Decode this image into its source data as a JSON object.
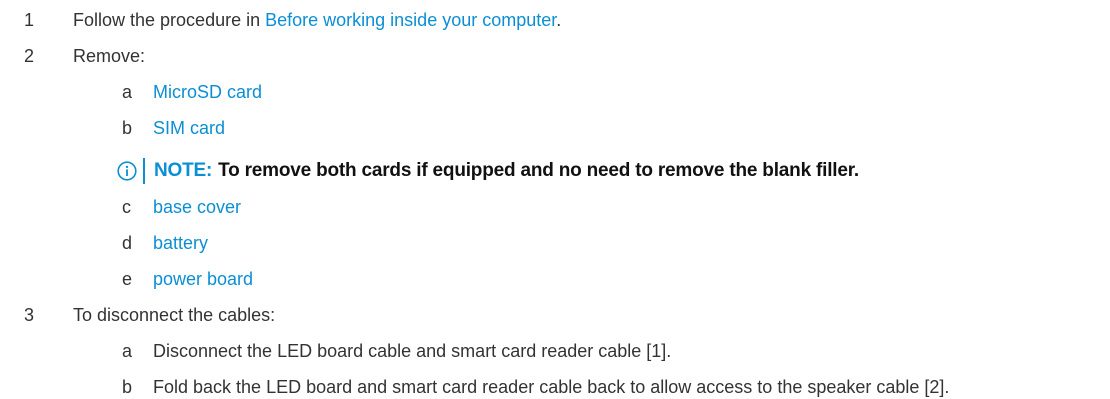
{
  "steps": [
    {
      "number": "1",
      "text_before": "Follow the procedure in ",
      "link": "Before working inside your computer",
      "text_after": "."
    },
    {
      "number": "2",
      "text": "Remove:",
      "substeps": [
        {
          "letter": "a",
          "link": "MicroSD card"
        },
        {
          "letter": "b",
          "link": "SIM card"
        }
      ],
      "note": {
        "label": "NOTE:",
        "text": "To remove both cards if equipped and no need to remove the blank filler."
      },
      "substeps_after_note": [
        {
          "letter": "c",
          "link": "base cover"
        },
        {
          "letter": "d",
          "link": "battery"
        },
        {
          "letter": "e",
          "link": "power board"
        }
      ]
    },
    {
      "number": "3",
      "text": "To disconnect the cables:",
      "substeps": [
        {
          "letter": "a",
          "text": "Disconnect the LED board cable and smart card reader cable [1]."
        },
        {
          "letter": "b",
          "text": "Fold back the LED board and smart card reader cable back to allow access to the speaker cable [2]."
        }
      ]
    }
  ],
  "colors": {
    "link": "#0b8fd4",
    "text": "#333333",
    "note_text": "#111111"
  },
  "icons": {
    "note": "info-circle-icon"
  }
}
